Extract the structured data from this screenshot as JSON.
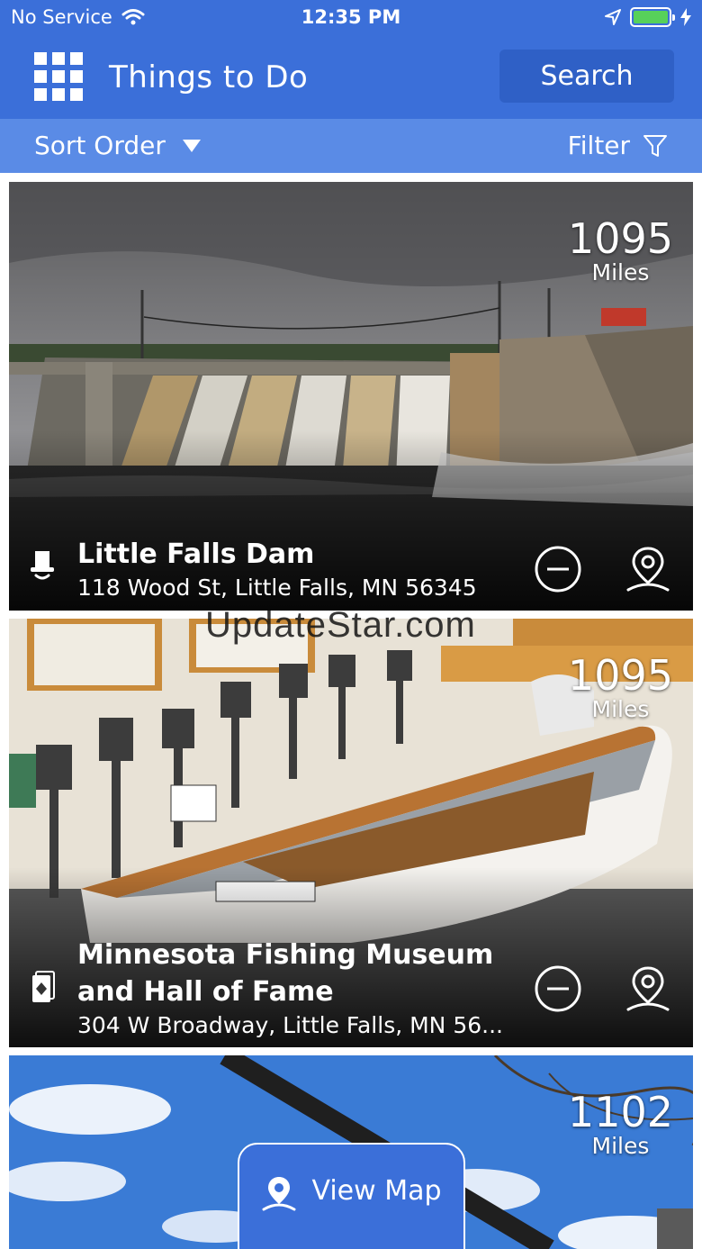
{
  "status_bar": {
    "carrier": "No Service",
    "time": "12:35 PM"
  },
  "nav": {
    "title": "Things to Do",
    "search_label": "Search"
  },
  "toolbar": {
    "sort_label": "Sort Order",
    "filter_label": "Filter"
  },
  "cards": [
    {
      "distance": "1095",
      "unit": "Miles",
      "title": "Little Falls Dam",
      "address": "118 Wood St, Little Falls, MN 56345",
      "category_icon": "top-hat-icon"
    },
    {
      "distance": "1095",
      "unit": "Miles",
      "title": "Minnesota Fishing Museum and Hall of Fame",
      "address": "304 W Broadway, Little Falls, MN 56...",
      "category_icon": "card-icon"
    },
    {
      "distance": "1102",
      "unit": "Miles",
      "category_icon": "none"
    }
  ],
  "watermark": "UpdateStar.com",
  "view_map_label": "View Map",
  "colors": {
    "primary": "#3b6fd9",
    "primary_dark": "#2f60c6",
    "sortbar": "#5a8be6",
    "battery": "#57d15a"
  }
}
